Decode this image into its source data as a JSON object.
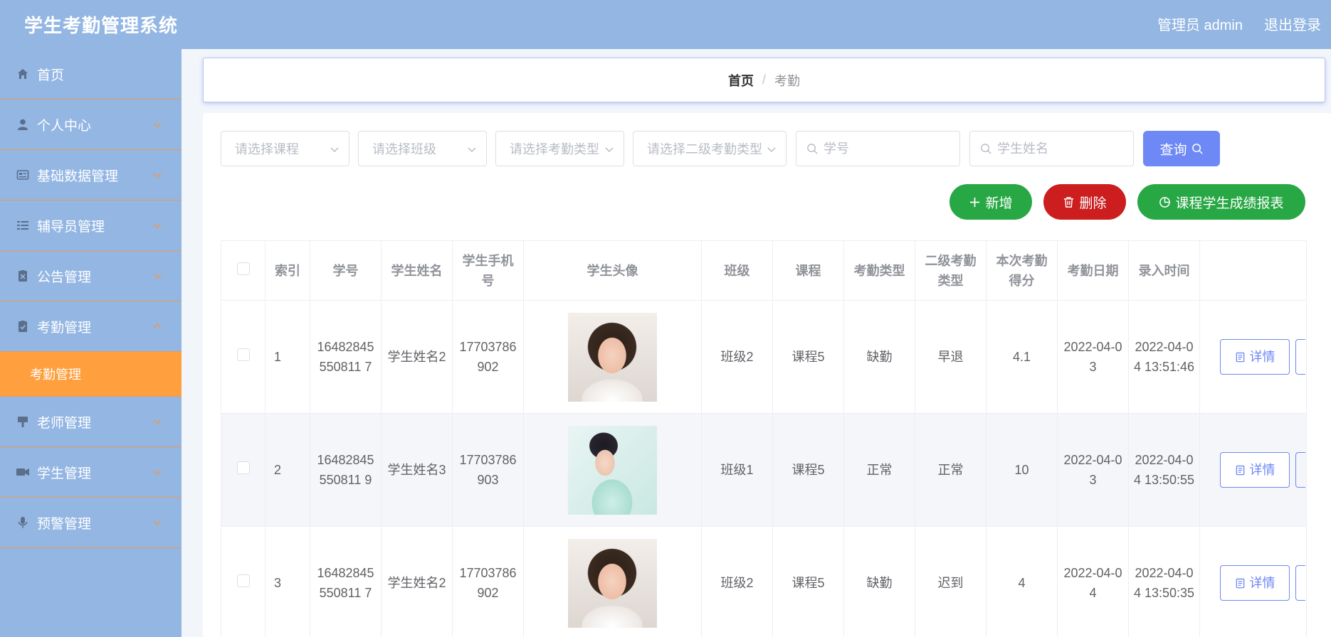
{
  "header": {
    "title": "学生考勤管理系统",
    "user_label": "管理员 admin",
    "logout_label": "退出登录"
  },
  "sidebar": {
    "items": [
      {
        "label": "首页",
        "icon": "home-icon"
      },
      {
        "label": "个人中心",
        "icon": "user-icon"
      },
      {
        "label": "基础数据管理",
        "icon": "id-card-icon"
      },
      {
        "label": "辅导员管理",
        "icon": "list-icon"
      },
      {
        "label": "公告管理",
        "icon": "notice-icon"
      },
      {
        "label": "考勤管理",
        "icon": "attendance-icon",
        "expanded": true,
        "children": [
          {
            "label": "考勤管理",
            "active": true
          }
        ]
      },
      {
        "label": "老师管理",
        "icon": "teacher-icon"
      },
      {
        "label": "学生管理",
        "icon": "student-icon"
      },
      {
        "label": "预警管理",
        "icon": "microphone-icon"
      }
    ],
    "active_color": "#ff9f3d",
    "bg_color": "#93b6e3"
  },
  "breadcrumb": {
    "home": "首页",
    "separator": "/",
    "current": "考勤"
  },
  "filters": {
    "course_placeholder": "请选择课程",
    "class_placeholder": "请选择班级",
    "type_placeholder": "请选择考勤类型",
    "subtype_placeholder": "请选择二级考勤类型",
    "student_no_placeholder": "学号",
    "student_name_placeholder": "学生姓名",
    "query_label": "查询"
  },
  "actions": {
    "add_label": "新增",
    "delete_label": "删除",
    "report_label": "课程学生成绩报表"
  },
  "table": {
    "columns": [
      "索引",
      "学号",
      "学生姓名",
      "学生手机号",
      "学生头像",
      "班级",
      "课程",
      "考勤类型",
      "二级考勤类型",
      "本次考勤得分",
      "考勤日期",
      "录入时间"
    ],
    "rows": [
      {
        "index": "1",
        "student_no": "16482845550811 7",
        "name": "学生姓名2",
        "phone": "17703786902",
        "class": "班级2",
        "course": "课程5",
        "type": "缺勤",
        "subtype": "早退",
        "score": "4.1",
        "date": "2022-04-03",
        "created": "2022-04-04 13:51:46",
        "detail": "详情"
      },
      {
        "index": "2",
        "student_no": "16482845550811 9",
        "name": "学生姓名3",
        "phone": "17703786903",
        "class": "班级1",
        "course": "课程5",
        "type": "正常",
        "subtype": "正常",
        "score": "10",
        "date": "2022-04-03",
        "created": "2022-04-04 13:50:55",
        "detail": "详情"
      },
      {
        "index": "3",
        "student_no": "16482845550811 7",
        "name": "学生姓名2",
        "phone": "17703786902",
        "class": "班级2",
        "course": "课程5",
        "type": "缺勤",
        "subtype": "迟到",
        "score": "4",
        "date": "2022-04-04",
        "created": "2022-04-04 13:50:35",
        "detail": "详情"
      }
    ]
  },
  "colors": {
    "primary": "#6e88f5",
    "success": "#28a745",
    "danger": "#cc1e1e"
  }
}
